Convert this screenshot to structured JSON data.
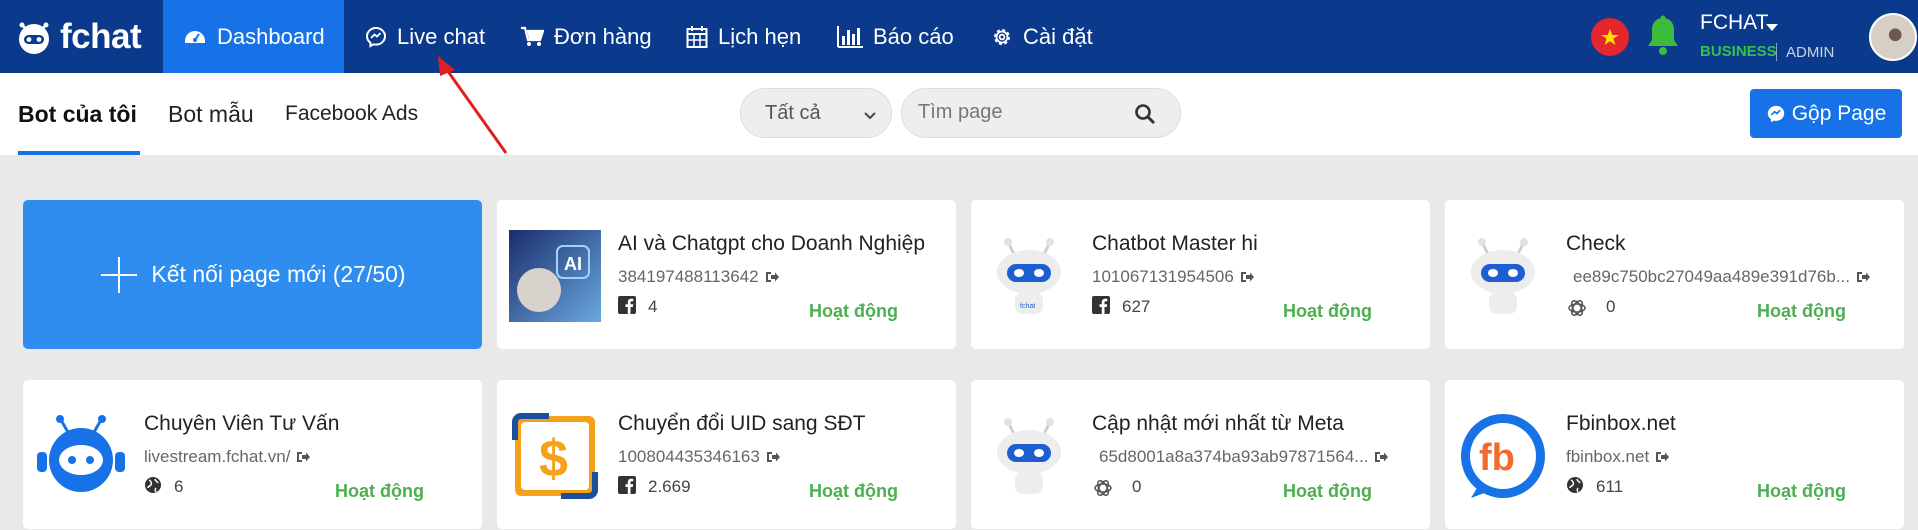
{
  "brand": {
    "name": "fchat"
  },
  "nav": [
    {
      "label": "Dashboard",
      "icon": "dashboard-icon",
      "active": true
    },
    {
      "label": "Live chat",
      "icon": "messenger-icon"
    },
    {
      "label": "Đơn hàng",
      "icon": "cart-icon"
    },
    {
      "label": "Lịch hẹn",
      "icon": "calendar-icon"
    },
    {
      "label": "Báo cáo",
      "icon": "bar-chart-icon"
    },
    {
      "label": "Cài đặt",
      "icon": "gear-icon"
    }
  ],
  "account": {
    "name": "FCHAT",
    "plan": "BUSINESS",
    "role": "ADMIN",
    "flag": "vietnam-flag-icon",
    "bell": "bell-icon"
  },
  "tabs": [
    {
      "label": "Bot của tôi",
      "active": true
    },
    {
      "label": "Bot mẫu"
    },
    {
      "label": "Facebook Ads"
    }
  ],
  "filter": {
    "selected": "Tất cả"
  },
  "search": {
    "placeholder": "Tìm page"
  },
  "merge_button": {
    "label": "Gộp Page"
  },
  "connect_card": {
    "label": "Kết nối page mới (27/50)"
  },
  "cards": [
    {
      "name": "AI và Chatgpt cho Doanh Nghiệp",
      "id": "384197488113642",
      "stat_icon": "facebook-icon",
      "count": "4",
      "status": "Hoạt động",
      "thumb": "ai-photo"
    },
    {
      "name": "Chatbot Master hi",
      "id": "101067131954506",
      "stat_icon": "facebook-icon",
      "count": "627",
      "status": "Hoạt động",
      "thumb": "robot"
    },
    {
      "name": "Check",
      "id": "ee89c750bc27049aa489e391d76b...",
      "stat_icon": "openai-icon",
      "count": "0",
      "status": "Hoạt động",
      "thumb": "robot"
    },
    {
      "name": "Chuyên Viên Tư Vấn",
      "id": "livestream.fchat.vn/",
      "stat_icon": "globe-icon",
      "count": "6",
      "status": "Hoạt động",
      "thumb": "fchat-bot"
    },
    {
      "name": "Chuyển đổi UID sang SĐT",
      "id": "100804435346163",
      "stat_icon": "facebook-icon",
      "count": "2.669",
      "status": "Hoạt động",
      "thumb": "dollar"
    },
    {
      "name": "Cập nhật mới nhất từ Meta",
      "id": "65d8001a8a374ba93ab97871564...",
      "stat_icon": "openai-icon",
      "count": "0",
      "status": "Hoạt động",
      "thumb": "robot"
    },
    {
      "name": "Fbinbox.net",
      "id": "fbinbox.net",
      "stat_icon": "globe-icon",
      "count": "611",
      "status": "Hoạt động",
      "thumb": "fb-logo"
    }
  ],
  "colors": {
    "navbar": "#0b3a8c",
    "accent": "#1672e6",
    "connect": "#2f8df0",
    "status_green": "#4caf50",
    "plan_green": "#33c24a"
  }
}
